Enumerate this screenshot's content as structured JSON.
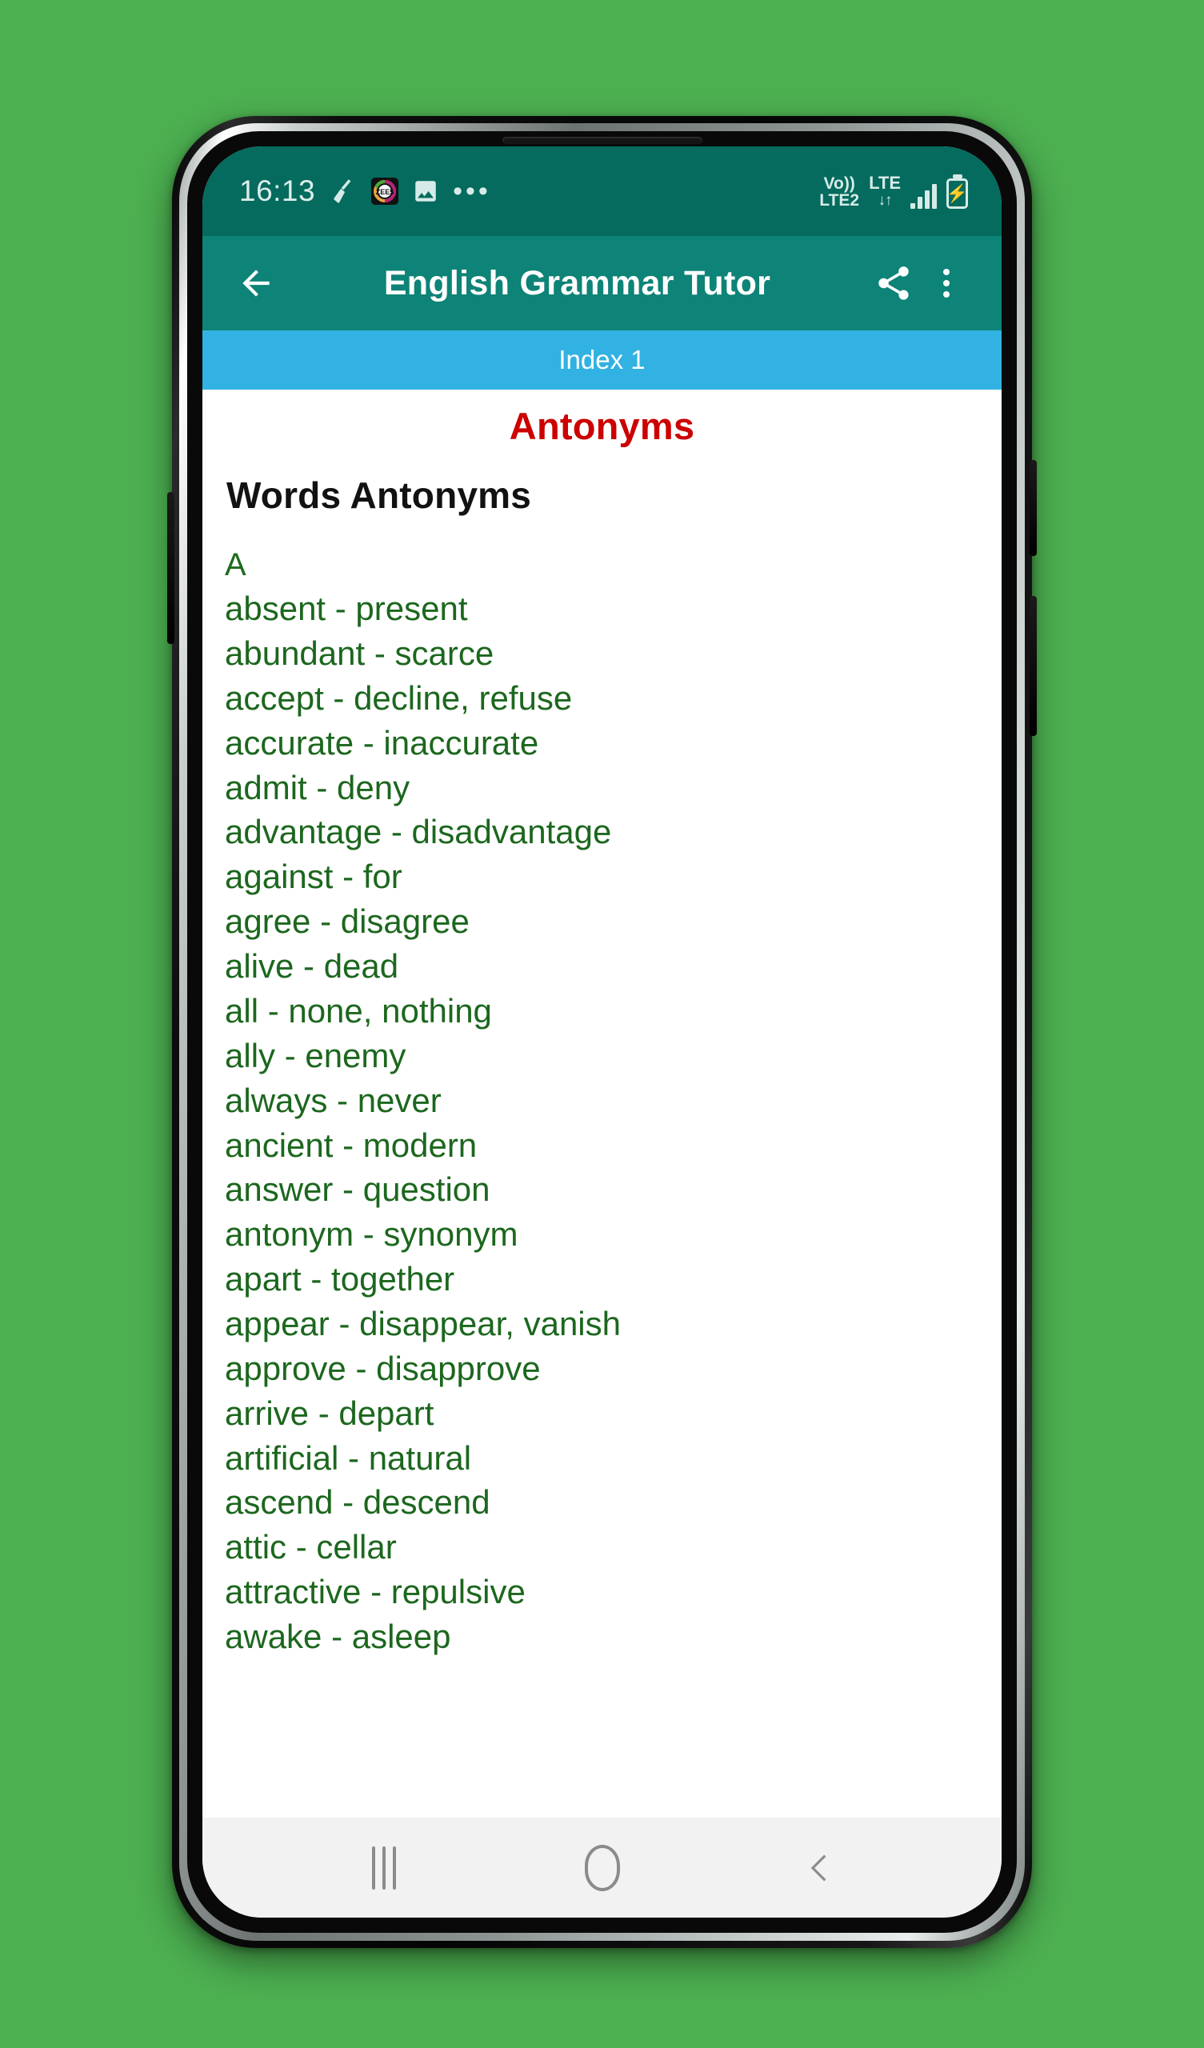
{
  "background_color": "#4caf50",
  "status_bar": {
    "time": "16:13",
    "left_icons": [
      "broom-cleaner-icon",
      "zee5-app-icon",
      "image-gallery-icon",
      "more-notifications-icon"
    ],
    "zee5_label": "ZEE5",
    "more_dots": "•••",
    "volte_top": "Vo))",
    "volte_bottom": "LTE2",
    "lte_label": "LTE",
    "lte_arrows": "↓↑",
    "right_icons": [
      "volte-icon",
      "lte-data-icon",
      "signal-bars-icon",
      "battery-charging-icon"
    ],
    "battery_glyph": "⚡"
  },
  "app_bar": {
    "back_icon": "back-arrow-icon",
    "title": "English Grammar Tutor",
    "share_icon": "share-icon",
    "overflow_icon": "three-dot-menu-icon"
  },
  "index_bar": {
    "label": "Index 1"
  },
  "content": {
    "page_title": "Antonyms",
    "page_title_color": "#cc0000",
    "section_heading": "Words Antonyms",
    "text_color": "#1c671e",
    "section_letter": "A",
    "entries": [
      "absent - present",
      "abundant - scarce",
      "accept - decline, refuse",
      "accurate - inaccurate",
      "admit - deny",
      "advantage - disadvantage",
      "against - for",
      "agree - disagree",
      "alive - dead",
      "all - none, nothing",
      "ally - enemy",
      "always - never",
      "ancient - modern",
      "answer - question",
      "antonym - synonym",
      "apart - together",
      "appear - disappear, vanish",
      "approve - disapprove",
      "arrive - depart",
      "artificial - natural",
      "ascend - descend",
      "attic - cellar",
      "attractive - repulsive",
      "awake - asleep"
    ]
  },
  "nav_bar": {
    "recents_icon": "recents-icon",
    "home_icon": "home-icon",
    "back_icon": "back-chevron-icon"
  }
}
